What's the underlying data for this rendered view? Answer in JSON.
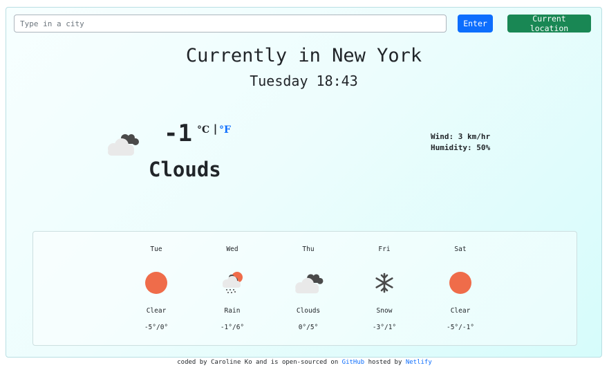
{
  "search": {
    "placeholder": "Type in a city",
    "value": ""
  },
  "buttons": {
    "enter": "Enter",
    "current_location": "Current location"
  },
  "header": {
    "title": "Currently in New York",
    "datetime": "Tuesday 18:43"
  },
  "current": {
    "temperature": "-1",
    "unit_c": "°C",
    "separator": "|",
    "unit_f": "°F",
    "description": "Clouds",
    "icon": "clouds-icon",
    "wind": "Wind: 3 km/hr",
    "humidity": "Humidity: 50%"
  },
  "forecast": [
    {
      "day": "Tue",
      "description": "Clear",
      "temps": "-5°/0°",
      "icon": "sun-icon"
    },
    {
      "day": "Wed",
      "description": "Rain",
      "temps": "-1°/6°",
      "icon": "rain-icon"
    },
    {
      "day": "Thu",
      "description": "Clouds",
      "temps": "0°/5°",
      "icon": "clouds-icon"
    },
    {
      "day": "Fri",
      "description": "Snow",
      "temps": "-3°/1°",
      "icon": "snowflake-icon"
    },
    {
      "day": "Sat",
      "description": "Clear",
      "temps": "-5°/-1°",
      "icon": "sun-icon"
    }
  ],
  "footer": {
    "prefix": "coded by Caroline Ko and is open-sourced on",
    "github": "GitHub",
    "middle": "hosted by",
    "netlify": "Netlify"
  },
  "colors": {
    "primary": "#0d6efd",
    "success": "#198754",
    "sun": "#ef6c4a",
    "cloud_dark": "#4a4a4a",
    "cloud_light": "#e6e6e6"
  }
}
